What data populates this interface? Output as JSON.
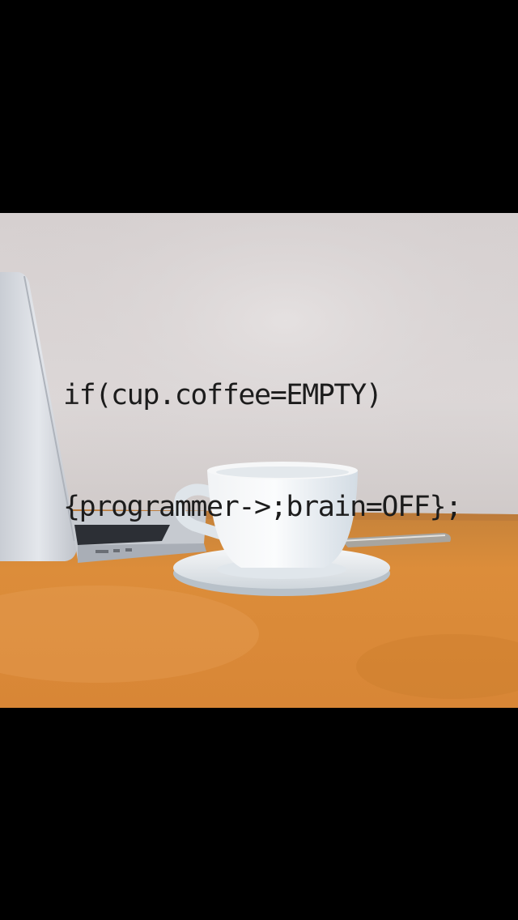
{
  "photo": {
    "code_caption": {
      "line1": "if(cup.coffee=EMPTY)",
      "line2": "{programmer->;brain=OFF};"
    },
    "icons": [
      "laptop",
      "coffee-cup",
      "saucer",
      "spoon"
    ],
    "colors": {
      "letterbox": "#000000",
      "wall": "#d9d4d4",
      "table": "#d98a36",
      "text": "#1c1c1c"
    }
  }
}
